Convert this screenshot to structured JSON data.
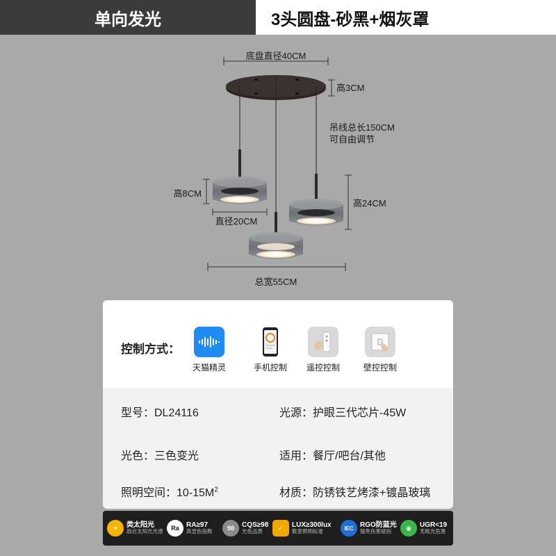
{
  "header": {
    "left_title": "单向发光",
    "right_title": "3头圆盘-砂黑+烟灰罩"
  },
  "dimensions": {
    "base_diameter": "底盘直径40CM",
    "base_height": "高3CM",
    "cable_length": "吊线总长150CM",
    "cable_adjustable": "可自由调节",
    "shade_height": "高8CM",
    "shade_diameter": "直径20CM",
    "drop_height": "高24CM",
    "total_width": "总宽55CM"
  },
  "control": {
    "title": "控制方式：",
    "items": [
      {
        "label": "天猫精灵",
        "icon": "tmall-genie-icon"
      },
      {
        "label": "手机控制",
        "icon": "phone-icon"
      },
      {
        "label": "遥控控制",
        "icon": "remote-icon"
      },
      {
        "label": "壁控控制",
        "icon": "wall-switch-icon"
      }
    ]
  },
  "specs": {
    "model": "型号：DL24116",
    "light_source": "光源：护眼三代芯片-45W",
    "light_color": "光色：三色变光",
    "applicable": "适用：餐厅/吧台/其他",
    "space_prefix": "照明空间：10-15M",
    "space_sup": "2",
    "material": "材质：防锈铁艺烤漆+镀晶玻璃"
  },
  "badges": [
    {
      "icon_text": "☀",
      "title": "类太阳光",
      "sub": "趋近太阳光光谱",
      "color": "#f5b400",
      "icon": "sun-icon"
    },
    {
      "icon_text": "Ra",
      "title": "RA≥97",
      "sub": "高显色指数",
      "color": "#ffffff",
      "icon": "ra-icon"
    },
    {
      "icon_text": "98",
      "title": "CQS≥98",
      "sub": "光色品质",
      "color": "#8a8a8a",
      "icon": "cqs-icon"
    },
    {
      "icon_text": "✓",
      "title": "LUX≥300lux",
      "sub": "教室照明标准",
      "color": "#f0a800",
      "icon": "lux-icon"
    },
    {
      "icon_text": "IEC",
      "title": "RGO防蓝光",
      "sub": "豁免伤害级别",
      "color": "#1e6fd9",
      "icon": "iec-icon"
    },
    {
      "icon_text": "◉",
      "title": "UGR<19",
      "sub": "无眩光危害",
      "color": "#39b54a",
      "icon": "eye-icon"
    }
  ]
}
